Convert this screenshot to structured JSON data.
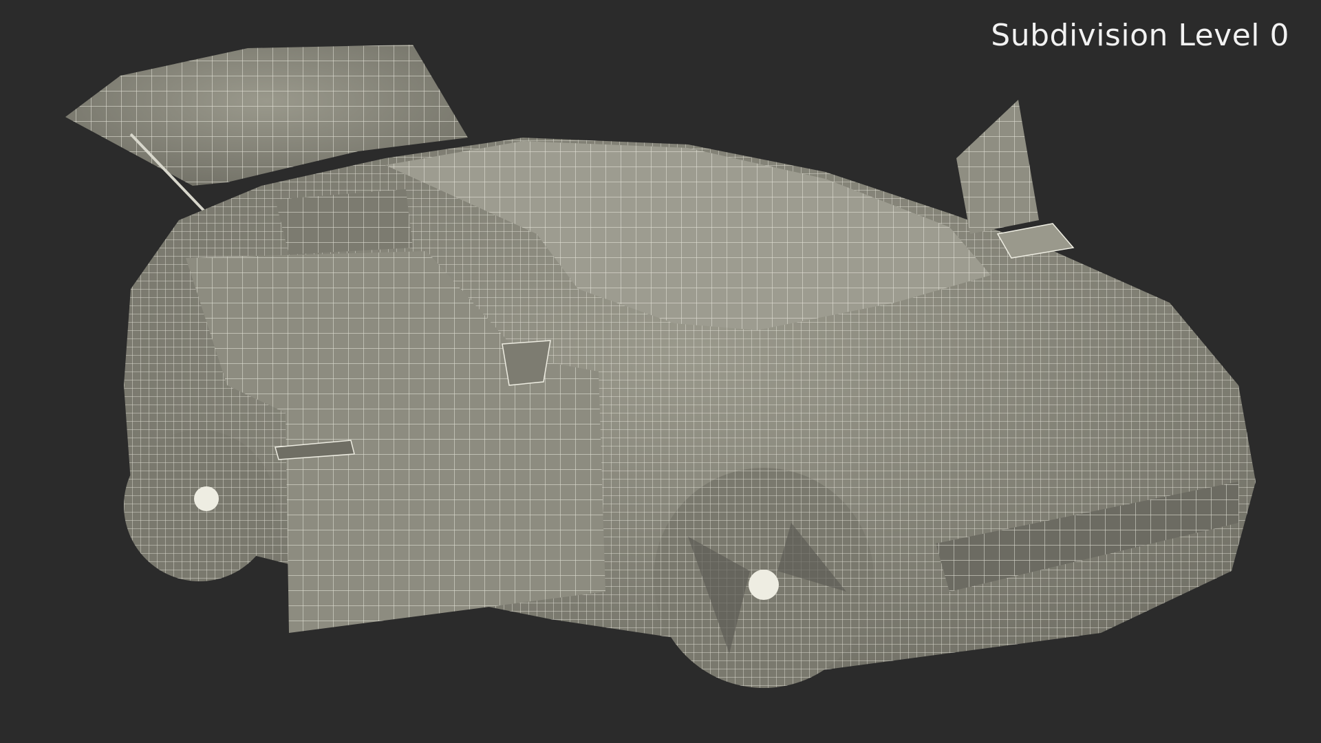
{
  "render": {
    "label": "Subdivision Level 0",
    "background_color": "#2b2b2b",
    "model_fill": "#8a8a7e",
    "wire_color": "#f0efe6",
    "subject": "wireframe electric hatchback with open doors and tailgate"
  }
}
